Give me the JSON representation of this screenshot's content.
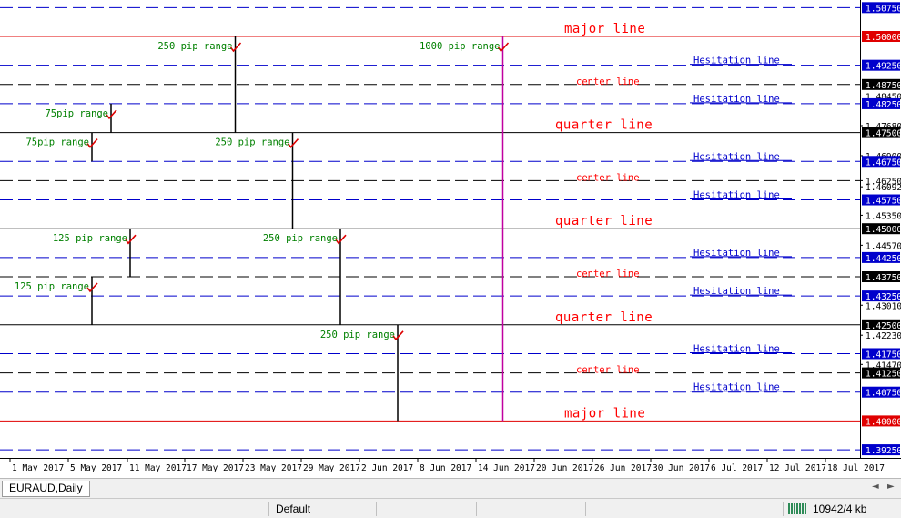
{
  "window": {
    "symbol_tab": "EURAUD,Daily"
  },
  "status": {
    "profile": "Default",
    "traffic": "10942/4 kb"
  },
  "tab_arrows": {
    "left": "◄",
    "right": "►"
  },
  "colors": {
    "background": "#ffffff",
    "blue_line": "#0000cc",
    "red_line": "#e00000",
    "black_line": "#000000",
    "magenta": "#c000a0",
    "red_text": "#ff0000",
    "green_text": "#008000",
    "blue_text": "#0000cc",
    "check": "#dd0000"
  },
  "chart_data": {
    "type": "line",
    "ylim": [
      1.3885,
      1.5095
    ],
    "x_labels": [
      "1 May 2017",
      "5 May 2017",
      "11 May 2017",
      "17 May 2017",
      "23 May 2017",
      "29 May 2017",
      "2 Jun 2017",
      "8 Jun 2017",
      "14 Jun 2017",
      "20 Jun 2017",
      "26 Jun 2017",
      "30 Jun 2017",
      "6 Jul 2017",
      "12 Jul 2017",
      "18 Jul 2017"
    ],
    "price_labels": [
      {
        "price": 1.5075,
        "text": "1.50750",
        "style": "blue"
      },
      {
        "price": 1.5,
        "text": "1.50000",
        "style": "red"
      },
      {
        "price": 1.4925,
        "text": "1.49250",
        "style": "blue"
      },
      {
        "price": 1.4875,
        "text": "1.48750",
        "style": "black"
      },
      {
        "price": 1.4845,
        "text": "1.48450",
        "style": "plain"
      },
      {
        "price": 1.4825,
        "text": "1.48250",
        "style": "blue"
      },
      {
        "price": 1.4768,
        "text": "1.47680",
        "style": "plain"
      },
      {
        "price": 1.475,
        "text": "1.47500",
        "style": "black"
      },
      {
        "price": 1.469,
        "text": "1.46900",
        "style": "plain"
      },
      {
        "price": 1.4675,
        "text": "1.46750",
        "style": "blue"
      },
      {
        "price": 1.4625,
        "text": "1.46250",
        "style": "plain"
      },
      {
        "price": 1.4609,
        "text": "1.46092",
        "style": "plain"
      },
      {
        "price": 1.4575,
        "text": "1.45750",
        "style": "blue"
      },
      {
        "price": 1.4535,
        "text": "1.45350",
        "style": "plain"
      },
      {
        "price": 1.45,
        "text": "1.45000",
        "style": "black"
      },
      {
        "price": 1.4457,
        "text": "1.44570",
        "style": "plain"
      },
      {
        "price": 1.4425,
        "text": "1.44250",
        "style": "blue"
      },
      {
        "price": 1.4375,
        "text": "1.43750",
        "style": "black"
      },
      {
        "price": 1.4325,
        "text": "1.43250",
        "style": "blue"
      },
      {
        "price": 1.4301,
        "text": "1.43010",
        "style": "plain"
      },
      {
        "price": 1.425,
        "text": "1.42500",
        "style": "black"
      },
      {
        "price": 1.4223,
        "text": "1.42230",
        "style": "plain"
      },
      {
        "price": 1.4175,
        "text": "1.41750",
        "style": "blue"
      },
      {
        "price": 1.4147,
        "text": "1.41470",
        "style": "plain"
      },
      {
        "price": 1.4125,
        "text": "1.41250",
        "style": "black"
      },
      {
        "price": 1.4075,
        "text": "1.40750",
        "style": "blue"
      },
      {
        "price": 1.4,
        "text": "1.40000",
        "style": "red"
      },
      {
        "price": 1.3925,
        "text": "1.39250",
        "style": "blue"
      }
    ],
    "levels": [
      {
        "price": 1.5075,
        "kind": "dashed"
      },
      {
        "price": 1.5,
        "kind": "major"
      },
      {
        "price": 1.4925,
        "kind": "dashed"
      },
      {
        "price": 1.4875,
        "kind": "center"
      },
      {
        "price": 1.4825,
        "kind": "dashed"
      },
      {
        "price": 1.475,
        "kind": "quarter"
      },
      {
        "price": 1.4675,
        "kind": "dashed"
      },
      {
        "price": 1.4625,
        "kind": "center"
      },
      {
        "price": 1.4575,
        "kind": "dashed"
      },
      {
        "price": 1.45,
        "kind": "quarter"
      },
      {
        "price": 1.4425,
        "kind": "dashed"
      },
      {
        "price": 1.4375,
        "kind": "center"
      },
      {
        "price": 1.4325,
        "kind": "dashed"
      },
      {
        "price": 1.425,
        "kind": "quarter"
      },
      {
        "price": 1.4175,
        "kind": "dashed"
      },
      {
        "price": 1.4125,
        "kind": "center"
      },
      {
        "price": 1.4075,
        "kind": "dashed"
      },
      {
        "price": 1.4,
        "kind": "major"
      },
      {
        "price": 1.3925,
        "kind": "dashed"
      }
    ],
    "level_labels": [
      {
        "price": 1.5,
        "text": "major line",
        "style": "red"
      },
      {
        "price": 1.4925,
        "text": "Hesitation line",
        "style": "blue"
      },
      {
        "price": 1.4875,
        "text": "center line",
        "style": "redsmall"
      },
      {
        "price": 1.4825,
        "text": "Hesitation line",
        "style": "blue"
      },
      {
        "price": 1.475,
        "text": "quarter line",
        "style": "red"
      },
      {
        "price": 1.4675,
        "text": "Hesitation line",
        "style": "blue"
      },
      {
        "price": 1.4625,
        "text": "center line",
        "style": "redsmall"
      },
      {
        "price": 1.4575,
        "text": "Hesitation line",
        "style": "blue"
      },
      {
        "price": 1.45,
        "text": "quarter line",
        "style": "red"
      },
      {
        "price": 1.4425,
        "text": "Hesitation line",
        "style": "blue"
      },
      {
        "price": 1.4375,
        "text": "center line",
        "style": "redsmall"
      },
      {
        "price": 1.4325,
        "text": "Hesitation line",
        "style": "blue"
      },
      {
        "price": 1.425,
        "text": "quarter line",
        "style": "red"
      },
      {
        "price": 1.4175,
        "text": "Hesitation line",
        "style": "blue"
      },
      {
        "price": 1.4125,
        "text": "center line",
        "style": "redsmall"
      },
      {
        "price": 1.4075,
        "text": "Hesitation line",
        "style": "blue"
      },
      {
        "price": 1.4,
        "text": "major line",
        "style": "red"
      }
    ],
    "ranges": [
      {
        "label": "250 pip range",
        "from": 1.475,
        "to": 1.5,
        "date": "22 May 2017"
      },
      {
        "label": "75pip range",
        "from": 1.475,
        "to": 1.4825,
        "date": "9 May 2017"
      },
      {
        "label": "75pip range",
        "from": 1.4675,
        "to": 1.475,
        "date": "7 May 2017"
      },
      {
        "label": "250 pip range",
        "from": 1.45,
        "to": 1.475,
        "date": "28 May 2017"
      },
      {
        "label": "125 pip range",
        "from": 1.4375,
        "to": 1.45,
        "date": "11 May 2017"
      },
      {
        "label": "250 pip range",
        "from": 1.425,
        "to": 1.45,
        "date": "2 Jun 2017"
      },
      {
        "label": "125 pip range",
        "from": 1.425,
        "to": 1.4375,
        "date": "7 May 2017"
      },
      {
        "label": "250 pip range",
        "from": 1.4,
        "to": 1.425,
        "date": "8 Jun 2017"
      },
      {
        "label": "1000 pip range",
        "from": 1.4,
        "to": 1.5,
        "date": "19 Jun 2017"
      }
    ]
  }
}
